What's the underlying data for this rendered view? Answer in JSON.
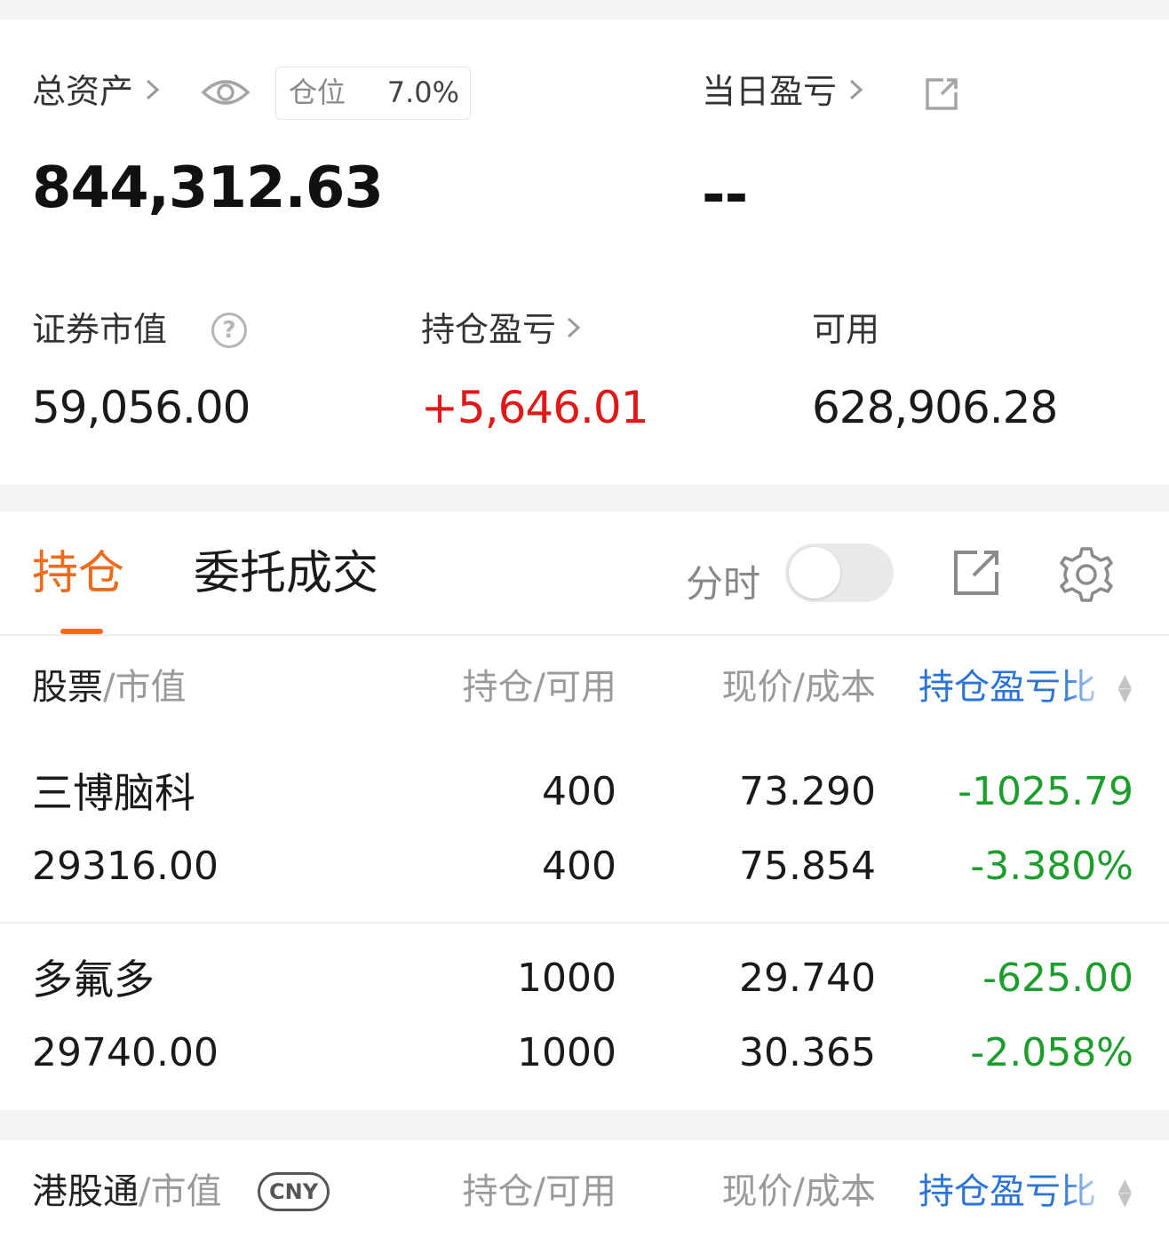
{
  "summary": {
    "total_assets_label": "总资产",
    "position_label": "仓位",
    "position_value": "7.0%",
    "total_assets_value": "844,312.63",
    "daily_pnl_label": "当日盈亏",
    "daily_pnl_value": "--",
    "market_value_label": "证券市值",
    "market_value": "59,056.00",
    "holding_pnl_label": "持仓盈亏",
    "holding_pnl_value": "+5,646.01",
    "available_label": "可用",
    "available_value": "628,906.28"
  },
  "tabs": {
    "holdings": "持仓",
    "orders": "委托成交",
    "intraday_label": "分时",
    "intraday_on": false
  },
  "table": {
    "headers": {
      "stock": "股票",
      "stock_sub": "/市值",
      "position": "持仓/可用",
      "price": "现价/成本",
      "pnl": "持仓盈亏比"
    },
    "rows": [
      {
        "name": "三博脑科",
        "market_value": "29316.00",
        "position": "400",
        "available": "400",
        "price": "73.290",
        "cost": "75.854",
        "pnl": "-1025.79",
        "pnl_pct": "-3.380%"
      },
      {
        "name": "多氟多",
        "market_value": "29740.00",
        "position": "1000",
        "available": "1000",
        "price": "29.740",
        "cost": "30.365",
        "pnl": "-625.00",
        "pnl_pct": "-2.058%"
      }
    ]
  },
  "hk": {
    "title": "港股通",
    "title_sub": "/市值",
    "currency": "CNY",
    "position": "持仓/可用",
    "price": "现价/成本",
    "pnl": "持仓盈亏比"
  },
  "colors": {
    "accent": "#ef6b1b",
    "up": "#e01818",
    "down": "#1b9e2b",
    "link": "#2a73d9"
  }
}
